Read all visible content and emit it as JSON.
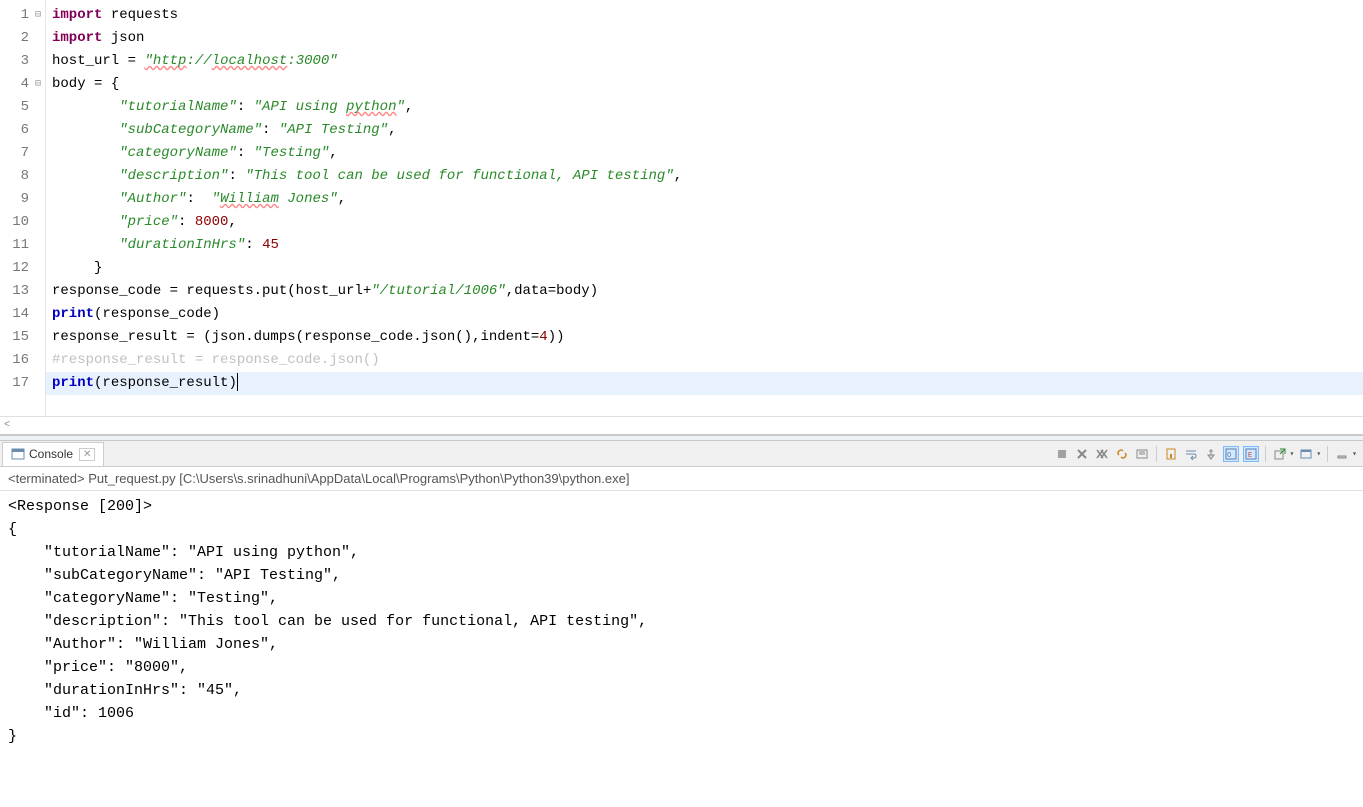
{
  "editor": {
    "lines": [
      {
        "n": 1,
        "fold": "⊟",
        "type": "code1"
      },
      {
        "n": 2,
        "type": "code2"
      },
      {
        "n": 3,
        "type": "code3"
      },
      {
        "n": 4,
        "fold": "⊟",
        "type": "code4"
      },
      {
        "n": 5,
        "type": "code5"
      },
      {
        "n": 6,
        "type": "code6"
      },
      {
        "n": 7,
        "type": "code7"
      },
      {
        "n": 8,
        "type": "code8"
      },
      {
        "n": 9,
        "type": "code9"
      },
      {
        "n": 10,
        "type": "code10"
      },
      {
        "n": 11,
        "type": "code11"
      },
      {
        "n": 12,
        "type": "code12"
      },
      {
        "n": 13,
        "type": "code13"
      },
      {
        "n": 14,
        "type": "code14"
      },
      {
        "n": 15,
        "type": "code15"
      },
      {
        "n": 16,
        "type": "code16"
      },
      {
        "n": 17,
        "type": "code17",
        "current": true
      }
    ],
    "strings": {
      "import": "import",
      "requests": "requests",
      "json": "json",
      "host_url": "host_url",
      "eq": " = ",
      "url_str": "\"http://localhost:3000\"",
      "body": "body",
      "brace_open": " = {",
      "k_tutorialName": "\"tutorialName\"",
      "v_tutorialName": "\"API using python\"",
      "k_subCategoryName": "\"subCategoryName\"",
      "v_subCategoryName": "\"API Testing\"",
      "k_categoryName": "\"categoryName\"",
      "v_categoryName": "\"Testing\"",
      "k_description": "\"description\"",
      "v_description": "\"This tool can be used for functional, API testing\"",
      "k_author": "\"Author\"",
      "v_author": "\"William Jones\"",
      "k_price": "\"price\"",
      "v_price": "8000",
      "k_duration": "\"durationInHrs\"",
      "v_duration": "45",
      "brace_close": "}",
      "response_code_line": "response_code = requests.put(host_url+",
      "path_str": "\"/tutorial/1006\"",
      "data_body": ",data=body)",
      "print1": "print",
      "resp_code_arg": "(response_code)",
      "response_result_line": "response_result = (json.dumps(response_code.json(),indent=",
      "indent4": "4",
      "closing": "))",
      "comment_line": "#response_result = response_code.json()",
      "print_result_arg": "(response_result)"
    }
  },
  "console": {
    "tab_label": "Console",
    "status": "<terminated> Put_request.py [C:\\Users\\s.srinadhuni\\AppData\\Local\\Programs\\Python\\Python39\\python.exe]",
    "output_lines": [
      "<Response [200]>",
      "{",
      "    \"tutorialName\": \"API using python\",",
      "    \"subCategoryName\": \"API Testing\",",
      "    \"categoryName\": \"Testing\",",
      "    \"description\": \"This tool can be used for functional, API testing\",",
      "    \"Author\": \"William Jones\",",
      "    \"price\": \"8000\",",
      "    \"durationInHrs\": \"45\",",
      "    \"id\": 1006",
      "}"
    ]
  }
}
